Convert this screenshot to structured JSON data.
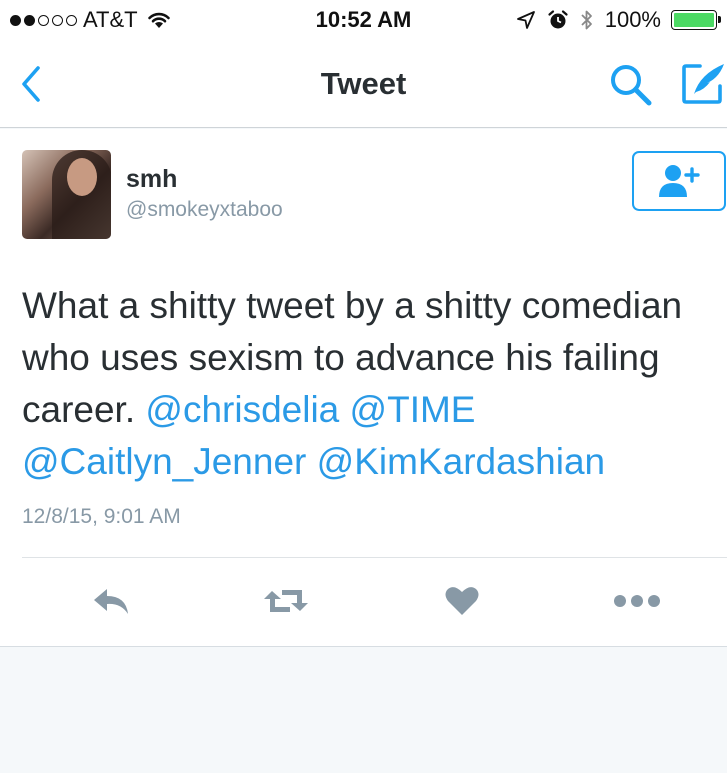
{
  "status_bar": {
    "carrier": "AT&T",
    "time": "10:52 AM",
    "battery_percent": "100%",
    "signal_bars_filled": 2,
    "signal_bars_total": 5,
    "battery_level": 1.0
  },
  "nav": {
    "title": "Tweet",
    "back_icon": "chevron-left-icon",
    "search_icon": "search-icon",
    "compose_icon": "compose-tweet-icon"
  },
  "tweet": {
    "display_name": "smh",
    "handle": "@smokeyxtaboo",
    "text_plain": "What a shitty tweet by a shitty comedian who uses sexism to advance his failing career. ",
    "mentions": [
      "@chrisdelia",
      "@TIME",
      "@Caitlyn_Jenner",
      "@KimKardashian"
    ],
    "timestamp": "12/8/15, 9:01 AM",
    "follow_icon": "add-user-icon"
  },
  "actions": [
    {
      "name": "reply",
      "icon": "reply-icon"
    },
    {
      "name": "retweet",
      "icon": "retweet-icon"
    },
    {
      "name": "like",
      "icon": "heart-icon"
    },
    {
      "name": "more",
      "icon": "more-dots-icon"
    }
  ],
  "colors": {
    "accent": "#1da1f2",
    "mention": "#2b9ae6",
    "icon_gray": "#8899a6",
    "battery": "#4cd964",
    "background": "#f5f8fa"
  }
}
